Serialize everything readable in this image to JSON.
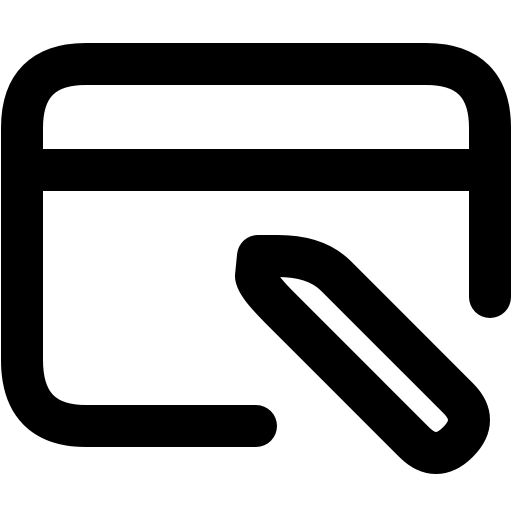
{
  "icon": {
    "name": "window-edit-icon",
    "stroke_color": "#000000",
    "background_color": "#ffffff"
  }
}
